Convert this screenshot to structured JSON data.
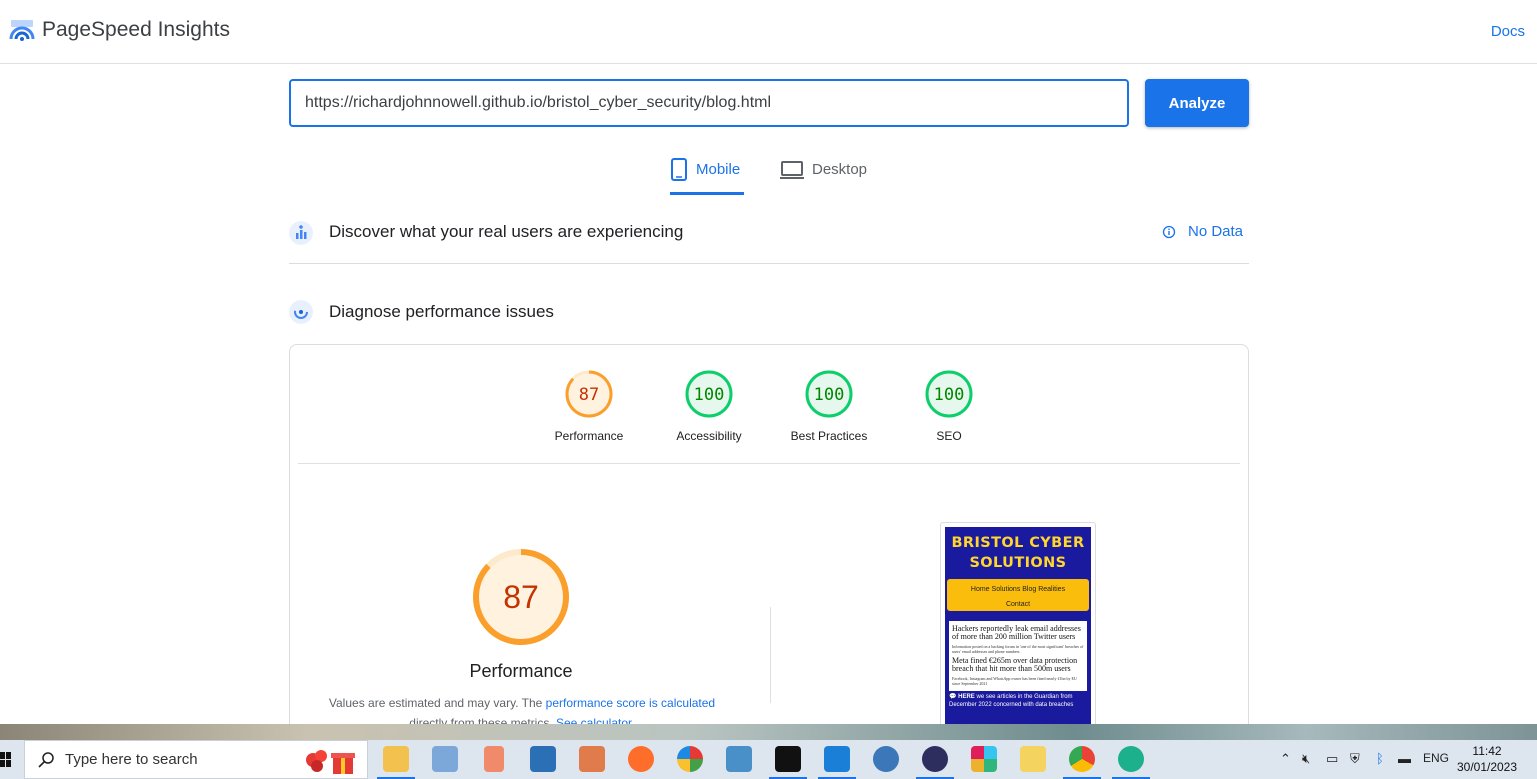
{
  "header": {
    "app_title": "PageSpeed Insights",
    "docs_link": "Docs"
  },
  "url_bar": {
    "value": "https://richardjohnnowell.github.io/bristol_cyber_security/blog.html",
    "analyze_label": "Analyze"
  },
  "device_tabs": [
    {
      "label": "Mobile",
      "active": true
    },
    {
      "label": "Desktop",
      "active": false
    }
  ],
  "field_data": {
    "title": "Discover what your real users are experiencing",
    "status": "No Data"
  },
  "diagnose": {
    "title": "Diagnose performance issues",
    "scores": [
      {
        "label": "Performance",
        "value": "87",
        "color": "#fa9f2c"
      },
      {
        "label": "Accessibility",
        "value": "100",
        "color": "#0cce6b"
      },
      {
        "label": "Best Practices",
        "value": "100",
        "color": "#0cce6b"
      },
      {
        "label": "SEO",
        "value": "100",
        "color": "#0cce6b"
      }
    ],
    "main_score": {
      "value": "87",
      "label": "Performance",
      "fraction": 0.87
    },
    "note": {
      "text1": "Values are estimated and may vary. The ",
      "link1": "performance score is calculated",
      "text2": "directly from these metrics. ",
      "link2": "See calculator",
      "text3": "."
    }
  },
  "screenshot_preview": {
    "site_title": "BRISTOL CYBER SOLUTIONS",
    "nav_line1": "Home  Solutions  Blog  Realities",
    "nav_line2": "Contact",
    "headline1": "Hackers reportedly leak email addresses of more than 200 million Twitter users",
    "subtext1": "Information posted on a hacking forum in 'one of the most significant' breaches of users' email addresses and phone numbers",
    "headline2": "Meta fined €265m over data protection breach that hit more than 500m users",
    "subtext2": "Facebook, Instagram and WhatsApp owner has been fined nearly £1bn by EU since September 2021",
    "footer_bold": "HERE",
    "footer_text": " we see articles in the Guardian from December 2022 concerned with data breaches"
  },
  "taskbar": {
    "search_placeholder": "Type here to search",
    "language": "ENG",
    "time": "11:42",
    "date": "30/01/2023"
  }
}
